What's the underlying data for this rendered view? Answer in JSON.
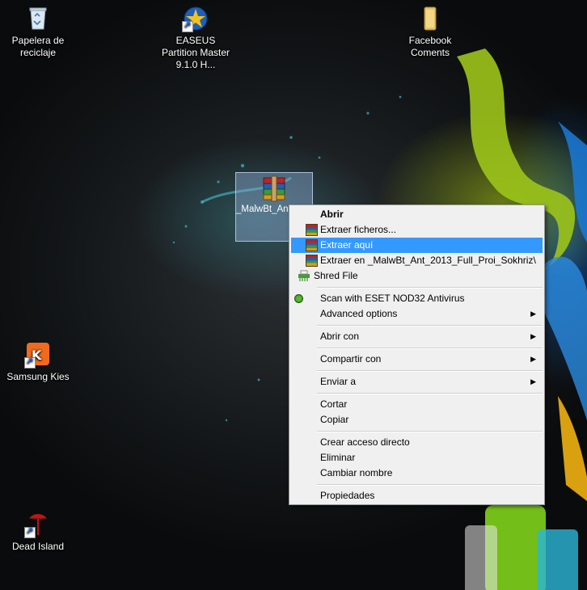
{
  "desktop": {
    "icons": [
      {
        "label": "Papelera de reciclaje"
      },
      {
        "label": "EASEUS Partition Master 9.1.0 H..."
      },
      {
        "label": "Facebook Coments"
      },
      {
        "label": "Samsung Kies"
      },
      {
        "label": "Dead Island"
      }
    ],
    "selected_file": {
      "label": "_MalwBt_An...3_Full_Proi_S...iz"
    }
  },
  "context_menu": {
    "items": [
      {
        "label": "Abrir",
        "bold": true
      },
      {
        "label": "Extraer ficheros..."
      },
      {
        "label": "Extraer aquí",
        "highlighted": true
      },
      {
        "label": "Extraer en _MalwBt_Ant_2013_Full_Proi_Sokhriz\\"
      },
      {
        "label": "Shred File"
      },
      {
        "label": "Scan with ESET NOD32 Antivirus"
      },
      {
        "label": "Advanced options",
        "submenu": true
      },
      {
        "label": "Abrir con",
        "submenu": true
      },
      {
        "label": "Compartir con",
        "submenu": true
      },
      {
        "label": "Enviar a",
        "submenu": true
      },
      {
        "label": "Cortar"
      },
      {
        "label": "Copiar"
      },
      {
        "label": "Crear acceso directo"
      },
      {
        "label": "Eliminar"
      },
      {
        "label": "Cambiar nombre"
      },
      {
        "label": "Propiedades"
      }
    ],
    "submenu_arrow": "▶",
    "highlight_color": "#3399ff"
  }
}
